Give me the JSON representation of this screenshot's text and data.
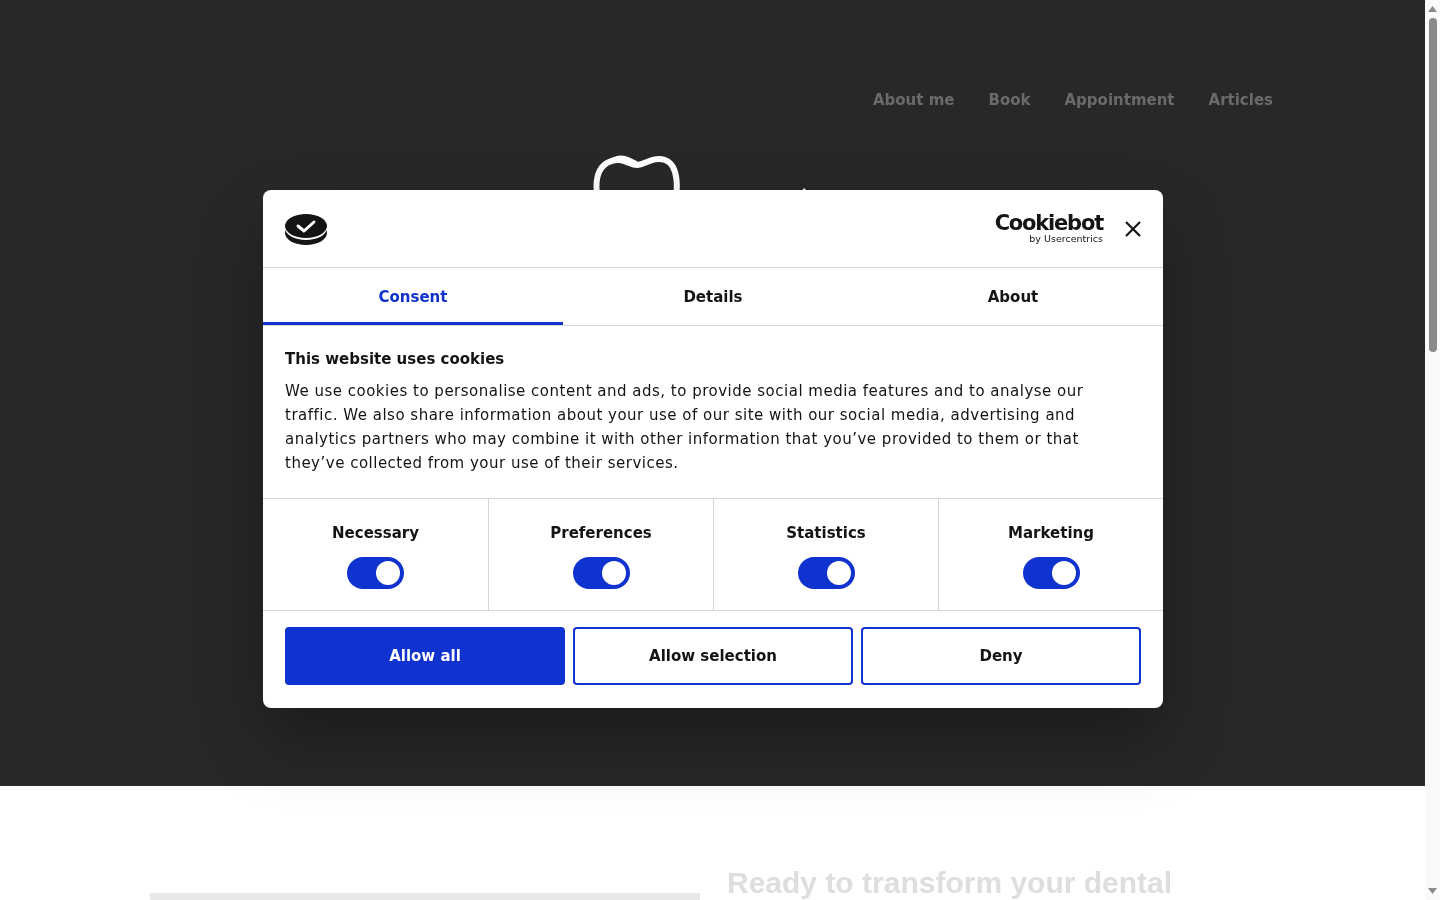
{
  "nav": [
    {
      "label": "About me"
    },
    {
      "label": "Book"
    },
    {
      "label": "Appointment"
    },
    {
      "label": "Articles"
    }
  ],
  "cookie_dialog": {
    "brand": {
      "name": "Cookiebot",
      "tagline": "by Usercentrics"
    },
    "tabs": [
      {
        "label": "Consent",
        "selected": true
      },
      {
        "label": "Details",
        "selected": false
      },
      {
        "label": "About",
        "selected": false
      }
    ],
    "title": "This website uses cookies",
    "body": "We use cookies to personalise content and ads, to provide social media features and to analyse our traffic. We also share information about your use of our site with our social media, advertising and analytics partners who may combine it with other information that you’ve provided to them or that they’ve collected from your use of their services.",
    "categories": [
      {
        "label": "Necessary",
        "on": true
      },
      {
        "label": "Preferences",
        "on": true
      },
      {
        "label": "Statistics",
        "on": true
      },
      {
        "label": "Marketing",
        "on": true
      }
    ],
    "buttons": [
      {
        "label": "Allow all",
        "kind": "primary"
      },
      {
        "label": "Allow selection",
        "kind": "outline"
      },
      {
        "label": "Deny",
        "kind": "outline"
      }
    ]
  },
  "section": {
    "heading": "Ready to transform your dental"
  }
}
